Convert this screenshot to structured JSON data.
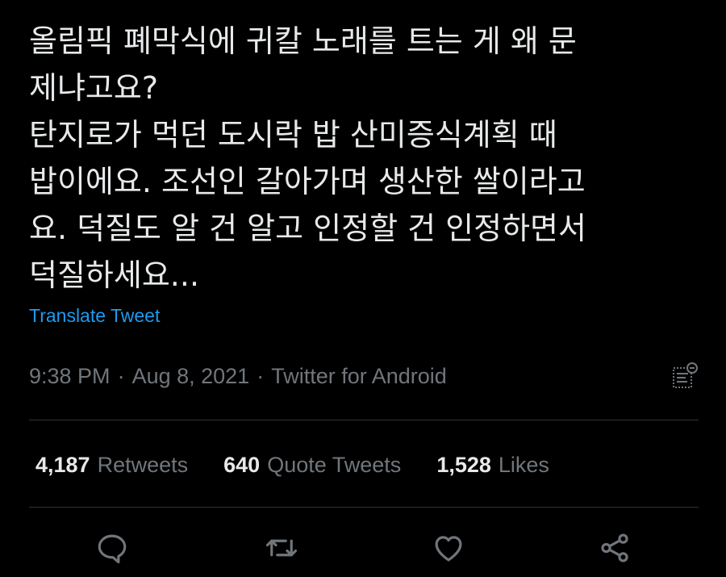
{
  "tweet": {
    "text": "올림픽 폐막식에 귀칼 노래를 트는 게 왜 문\n제냐고요?\n탄지로가 먹던 도시락 밥 산미증식계획 때\n밥이에요. 조선인 갈아가며 생산한 쌀이라고\n요. 덕질도 알 건 알고 인정할 건 인정하면서\n덕질하세요...",
    "translate_label": "Translate Tweet",
    "time": "9:38 PM",
    "date": "Aug 8, 2021",
    "source": "Twitter for Android",
    "separator": "·"
  },
  "stats": {
    "retweets_count": "4,187",
    "retweets_label": "Retweets",
    "quote_count": "640",
    "quote_label": "Quote Tweets",
    "likes_count": "1,528",
    "likes_label": "Likes"
  },
  "icons": {
    "analytics": "analytics-icon",
    "reply": "reply-icon",
    "retweet": "retweet-icon",
    "like": "like-icon",
    "share": "share-icon"
  },
  "colors": {
    "background": "#000000",
    "text": "#E7E9EA",
    "secondary": "#71767B",
    "link": "#1D9BF0",
    "divider": "#2F3336"
  }
}
